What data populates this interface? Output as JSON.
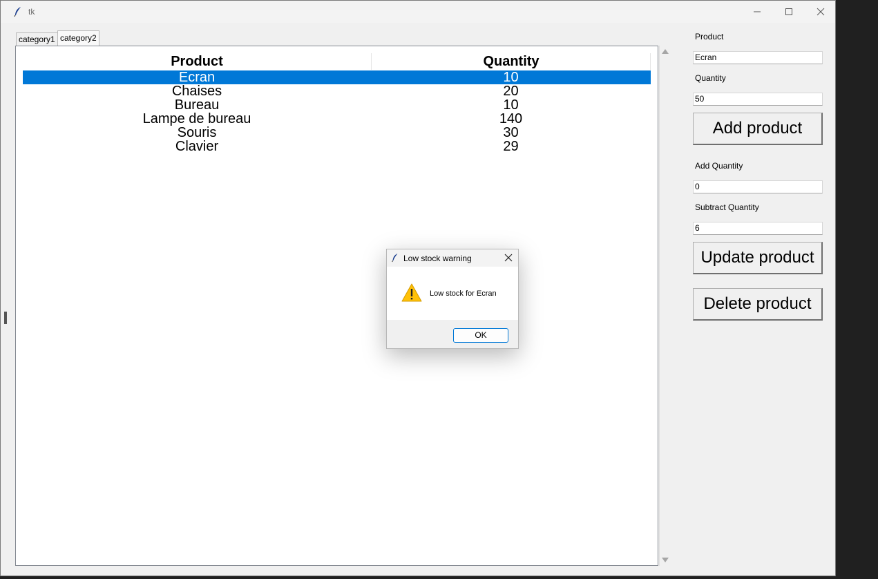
{
  "window": {
    "title": "tk"
  },
  "tabs": [
    "category1",
    "category2"
  ],
  "tree": {
    "columns": [
      "Product",
      "Quantity"
    ],
    "rows": [
      {
        "product": "Ecran",
        "quantity": "10",
        "selected": true
      },
      {
        "product": "Chaises",
        "quantity": "20"
      },
      {
        "product": "Bureau",
        "quantity": "10"
      },
      {
        "product": "Lampe de bureau",
        "quantity": "140"
      },
      {
        "product": "Souris",
        "quantity": "30"
      },
      {
        "product": "Clavier",
        "quantity": "29"
      }
    ]
  },
  "form": {
    "product_label": "Product",
    "product_value": "Ecran",
    "quantity_label": "Quantity",
    "quantity_value": "50",
    "add_button": "Add product",
    "add_quantity_label": "Add Quantity",
    "add_quantity_value": "0",
    "subtract_quantity_label": "Subtract Quantity",
    "subtract_quantity_value": "6",
    "update_button": "Update product",
    "delete_button": "Delete product"
  },
  "dialog": {
    "title": "Low stock warning",
    "message": "Low stock for Ecran",
    "ok": "OK",
    "icon": "warning-icon"
  },
  "colors": {
    "selection": "#0078d7",
    "warning": "#ffc107"
  }
}
